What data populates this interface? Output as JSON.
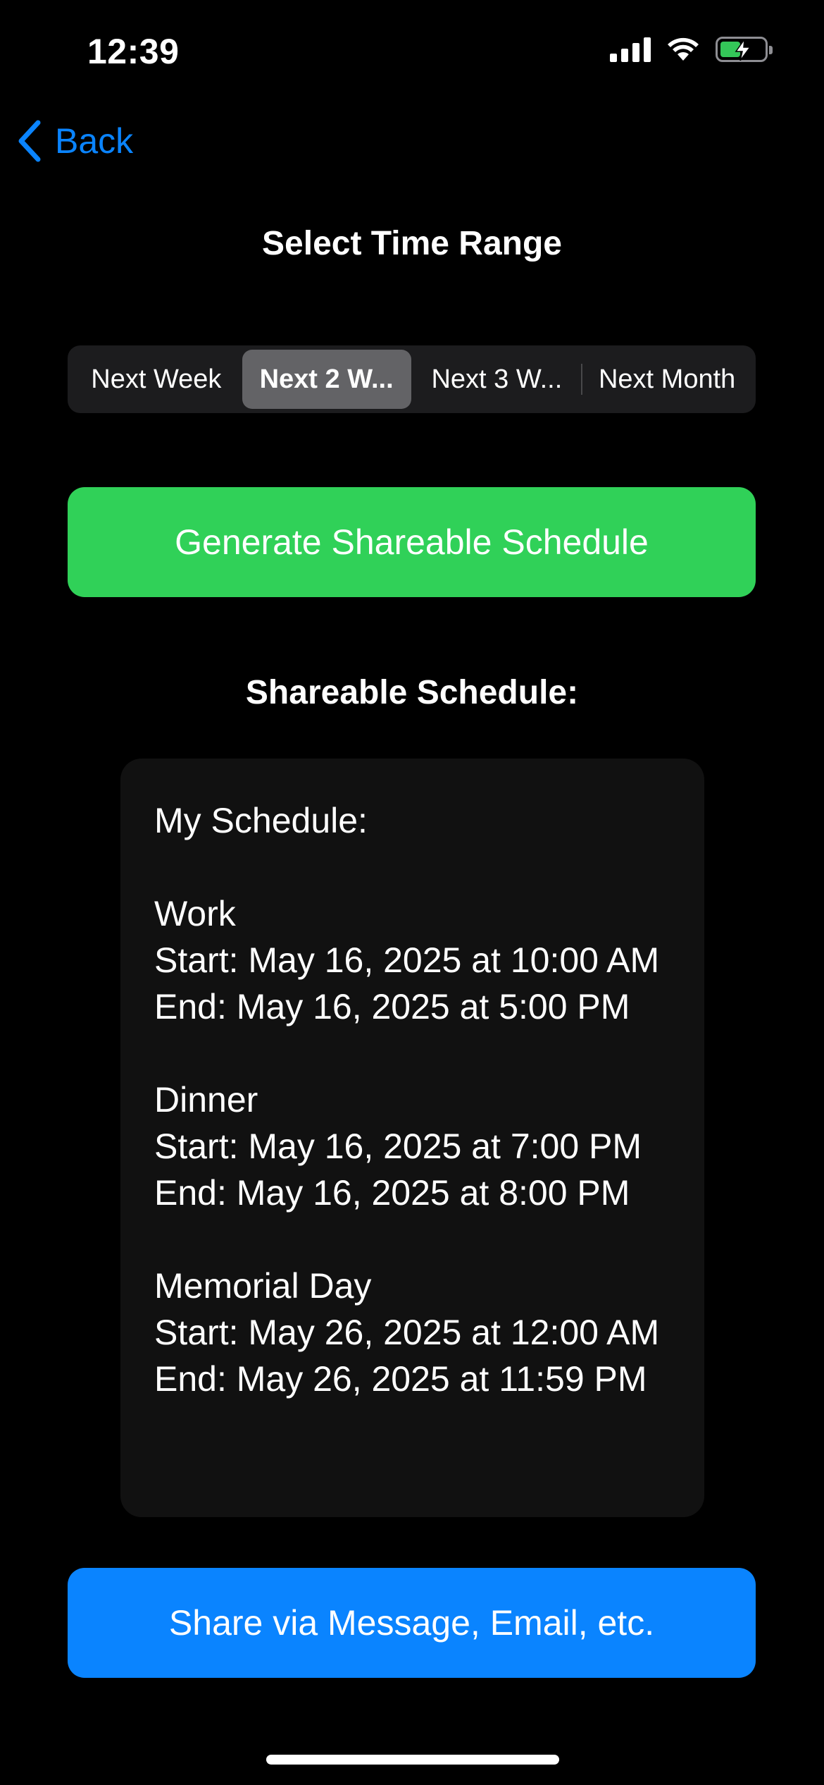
{
  "status_bar": {
    "time": "12:39",
    "battery_color": "#34c759"
  },
  "nav": {
    "back_label": "Back",
    "accent_color": "#0a84ff"
  },
  "title": "Select Time Range",
  "time_range": {
    "segments": [
      "Next Week",
      "Next 2 W...",
      "Next 3 W...",
      "Next Month"
    ],
    "selected": "Next 2 W..."
  },
  "generate_button": {
    "label": "Generate Shareable Schedule",
    "color": "#30d158"
  },
  "schedule": {
    "heading": "Shareable Schedule:",
    "intro": "My Schedule:",
    "events": [
      {
        "name": "Work",
        "start": "Start: May 16, 2025 at 10:00 AM",
        "end": "End: May 16, 2025 at 5:00 PM"
      },
      {
        "name": "Dinner",
        "start": "Start: May 16, 2025 at 7:00 PM",
        "end": "End: May 16, 2025 at 8:00 PM"
      },
      {
        "name": "Memorial Day",
        "start": "Start: May 26, 2025 at 12:00 AM",
        "end": "End: May 26, 2025 at 11:59 PM"
      }
    ]
  },
  "share_button": {
    "label": "Share via Message, Email, etc.",
    "color": "#0a84ff"
  }
}
